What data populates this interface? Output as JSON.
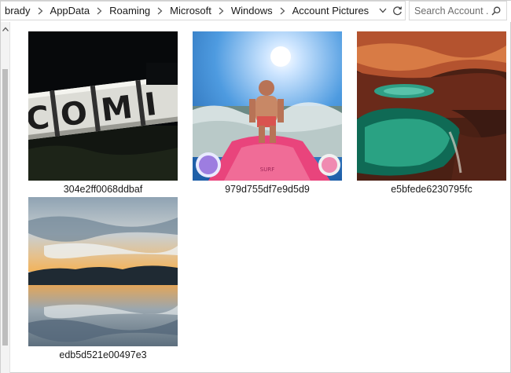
{
  "address_bar": {
    "breadcrumbs": [
      "brady",
      "AppData",
      "Roaming",
      "Microsoft",
      "Windows",
      "Account Pictures"
    ]
  },
  "search": {
    "placeholder": "Search Account ..."
  },
  "files": [
    {
      "name": "304e2ff0068ddbaf",
      "thumbnail": "illuminated-letters-night"
    },
    {
      "name": "979d755df7e9d5d9",
      "thumbnail": "paddleboard-surfer"
    },
    {
      "name": "e5bfede6230795fc",
      "thumbnail": "red-rock-green-pool"
    },
    {
      "name": "edb5d521e00497e3",
      "thumbnail": "sunset-lake-reflection"
    }
  ],
  "colors": {
    "window_bg": "#ffffff",
    "border": "#d9d9d9",
    "scroll_track": "#f3f3f3",
    "scroll_thumb": "#bdbdbd"
  }
}
